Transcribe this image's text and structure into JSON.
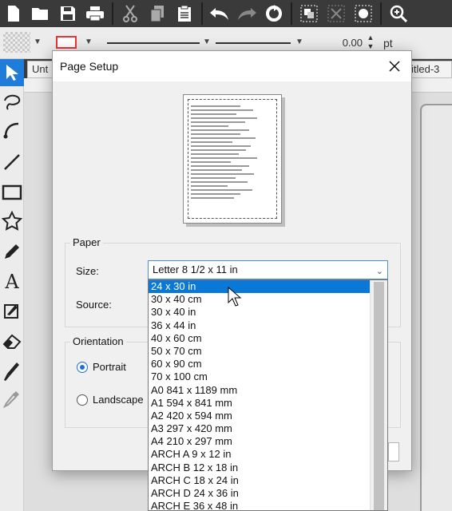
{
  "toolbar": {
    "icons": [
      "new-icon",
      "open-icon",
      "save-icon",
      "print-icon",
      "cut-icon",
      "copy-icon",
      "paste-icon",
      "undo-icon",
      "redo-icon",
      "refresh-icon",
      "group-icon",
      "ungroup-icon",
      "fill-icon",
      "zoom-icon"
    ]
  },
  "propbar": {
    "stroke_width": "0.00",
    "unit": "pt"
  },
  "tabs": {
    "left": "Unt",
    "right": "itled-3"
  },
  "dialog": {
    "title": "Page Setup",
    "paper_group": "Paper",
    "size_label": "Size:",
    "source_label": "Source:",
    "size_value": "Letter 8 1/2 x 11 in",
    "orientation_group": "Orientation",
    "portrait_label": "Portrait",
    "landscape_label": "Landscape",
    "orientation_selected": "Portrait"
  },
  "size_options": [
    "24 x 30 in",
    "30 x 40 cm",
    "30 x 40 in",
    "36 x 44 in",
    "40 x 60 cm",
    "50 x 70 cm",
    "60 x 90 cm",
    "70 x 100 cm",
    "A0 841 x 1189 mm",
    "A1 594 x 841 mm",
    "A2 420 x 594 mm",
    "A3 297 x 420 mm",
    "A4 210 x 297 mm",
    "ARCH A 9 x 12 in",
    "ARCH B 12 x 18 in",
    "ARCH C 18 x 24 in",
    "ARCH D 24 x 36 in",
    "ARCH E 36 x 48 in"
  ],
  "size_highlighted": "24 x 30 in",
  "colors": {
    "highlight": "#0a78d7",
    "tool_active": "#1f7cd8"
  }
}
